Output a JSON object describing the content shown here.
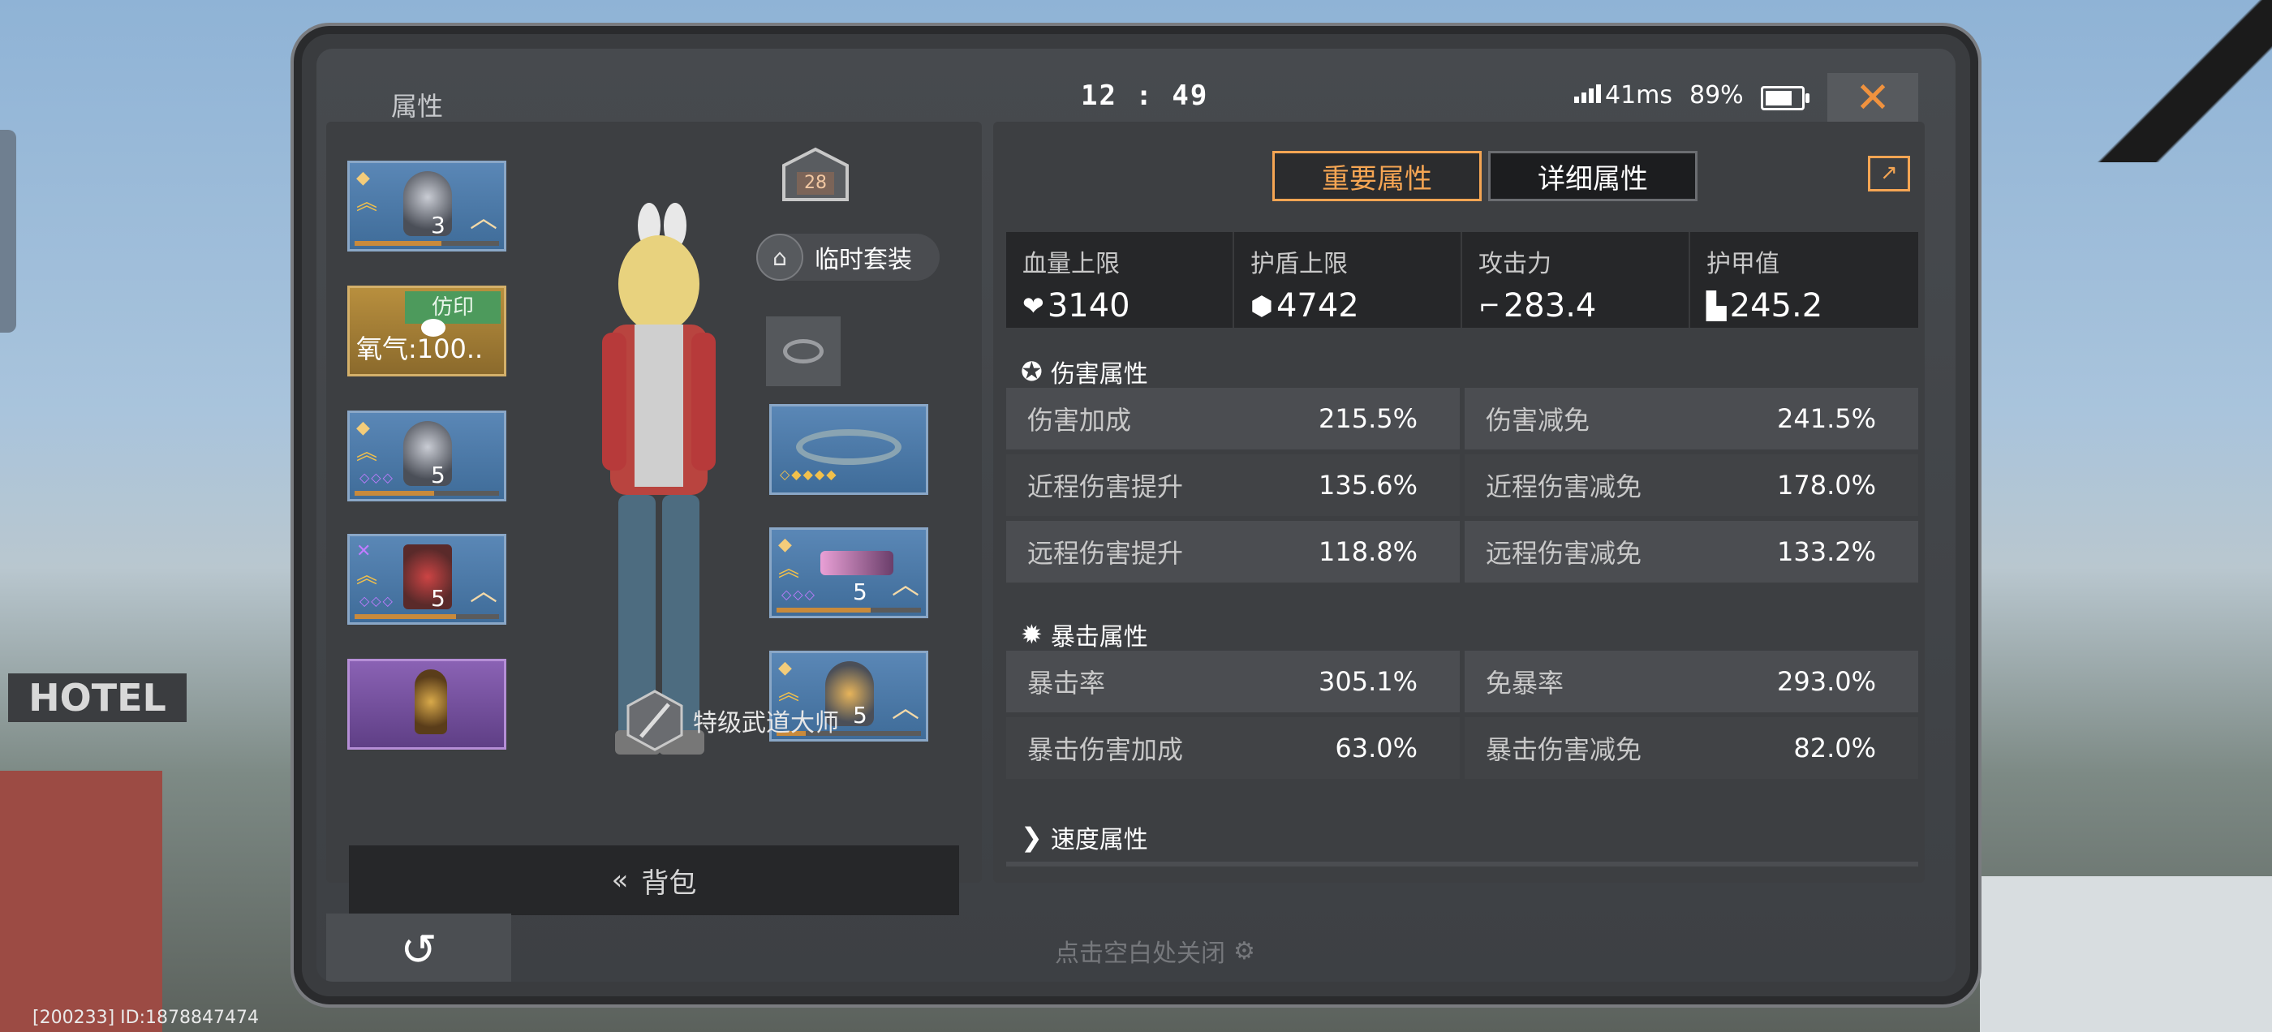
{
  "header": {
    "title": "属性",
    "time": "12 : 49",
    "ping": "41ms",
    "battery": "89%",
    "battery_level": 0.89,
    "close_icon": "close-icon"
  },
  "left": {
    "slots": [
      {
        "level": "3",
        "extra": ""
      },
      {
        "badge": "仿印",
        "text": "氧气:100.."
      },
      {
        "level": "5"
      },
      {
        "level": "5"
      },
      {}
    ],
    "right_slots": [
      {},
      {
        "level": "5"
      },
      {
        "level": "5"
      }
    ],
    "house_number": "28",
    "temp_suit": "临时套装",
    "rank": "特级武道大师",
    "bag": "背包",
    "bag_arrow": "«"
  },
  "tabs": {
    "important": "重要属性",
    "detailed": "详细属性"
  },
  "key_stats": [
    {
      "label": "血量上限",
      "icon": "heart-icon",
      "value": "3140"
    },
    {
      "label": "护盾上限",
      "icon": "shield-icon",
      "value": "4742"
    },
    {
      "label": "攻击力",
      "icon": "gun-icon",
      "value": "283.4"
    },
    {
      "label": "护甲值",
      "icon": "armor-icon",
      "value": "245.2"
    }
  ],
  "damage": {
    "title": "伤害属性",
    "rows": [
      [
        {
          "name": "伤害加成",
          "value": "215.5%"
        },
        {
          "name": "伤害减免",
          "value": "241.5%"
        }
      ],
      [
        {
          "name": "近程伤害提升",
          "value": "135.6%"
        },
        {
          "name": "近程伤害减免",
          "value": "178.0%"
        }
      ],
      [
        {
          "name": "远程伤害提升",
          "value": "118.8%"
        },
        {
          "name": "远程伤害减免",
          "value": "133.2%"
        }
      ]
    ]
  },
  "crit": {
    "title": "暴击属性",
    "rows": [
      [
        {
          "name": "暴击率",
          "value": "305.1%"
        },
        {
          "name": "免暴率",
          "value": "293.0%"
        }
      ],
      [
        {
          "name": "暴击伤害加成",
          "value": "63.0%"
        },
        {
          "name": "暴击伤害减免",
          "value": "82.0%"
        }
      ]
    ]
  },
  "speed": {
    "title": "速度属性"
  },
  "footer": {
    "close_hint": "点击空白处关闭",
    "id_text": "[200233] ID:1878847474"
  }
}
